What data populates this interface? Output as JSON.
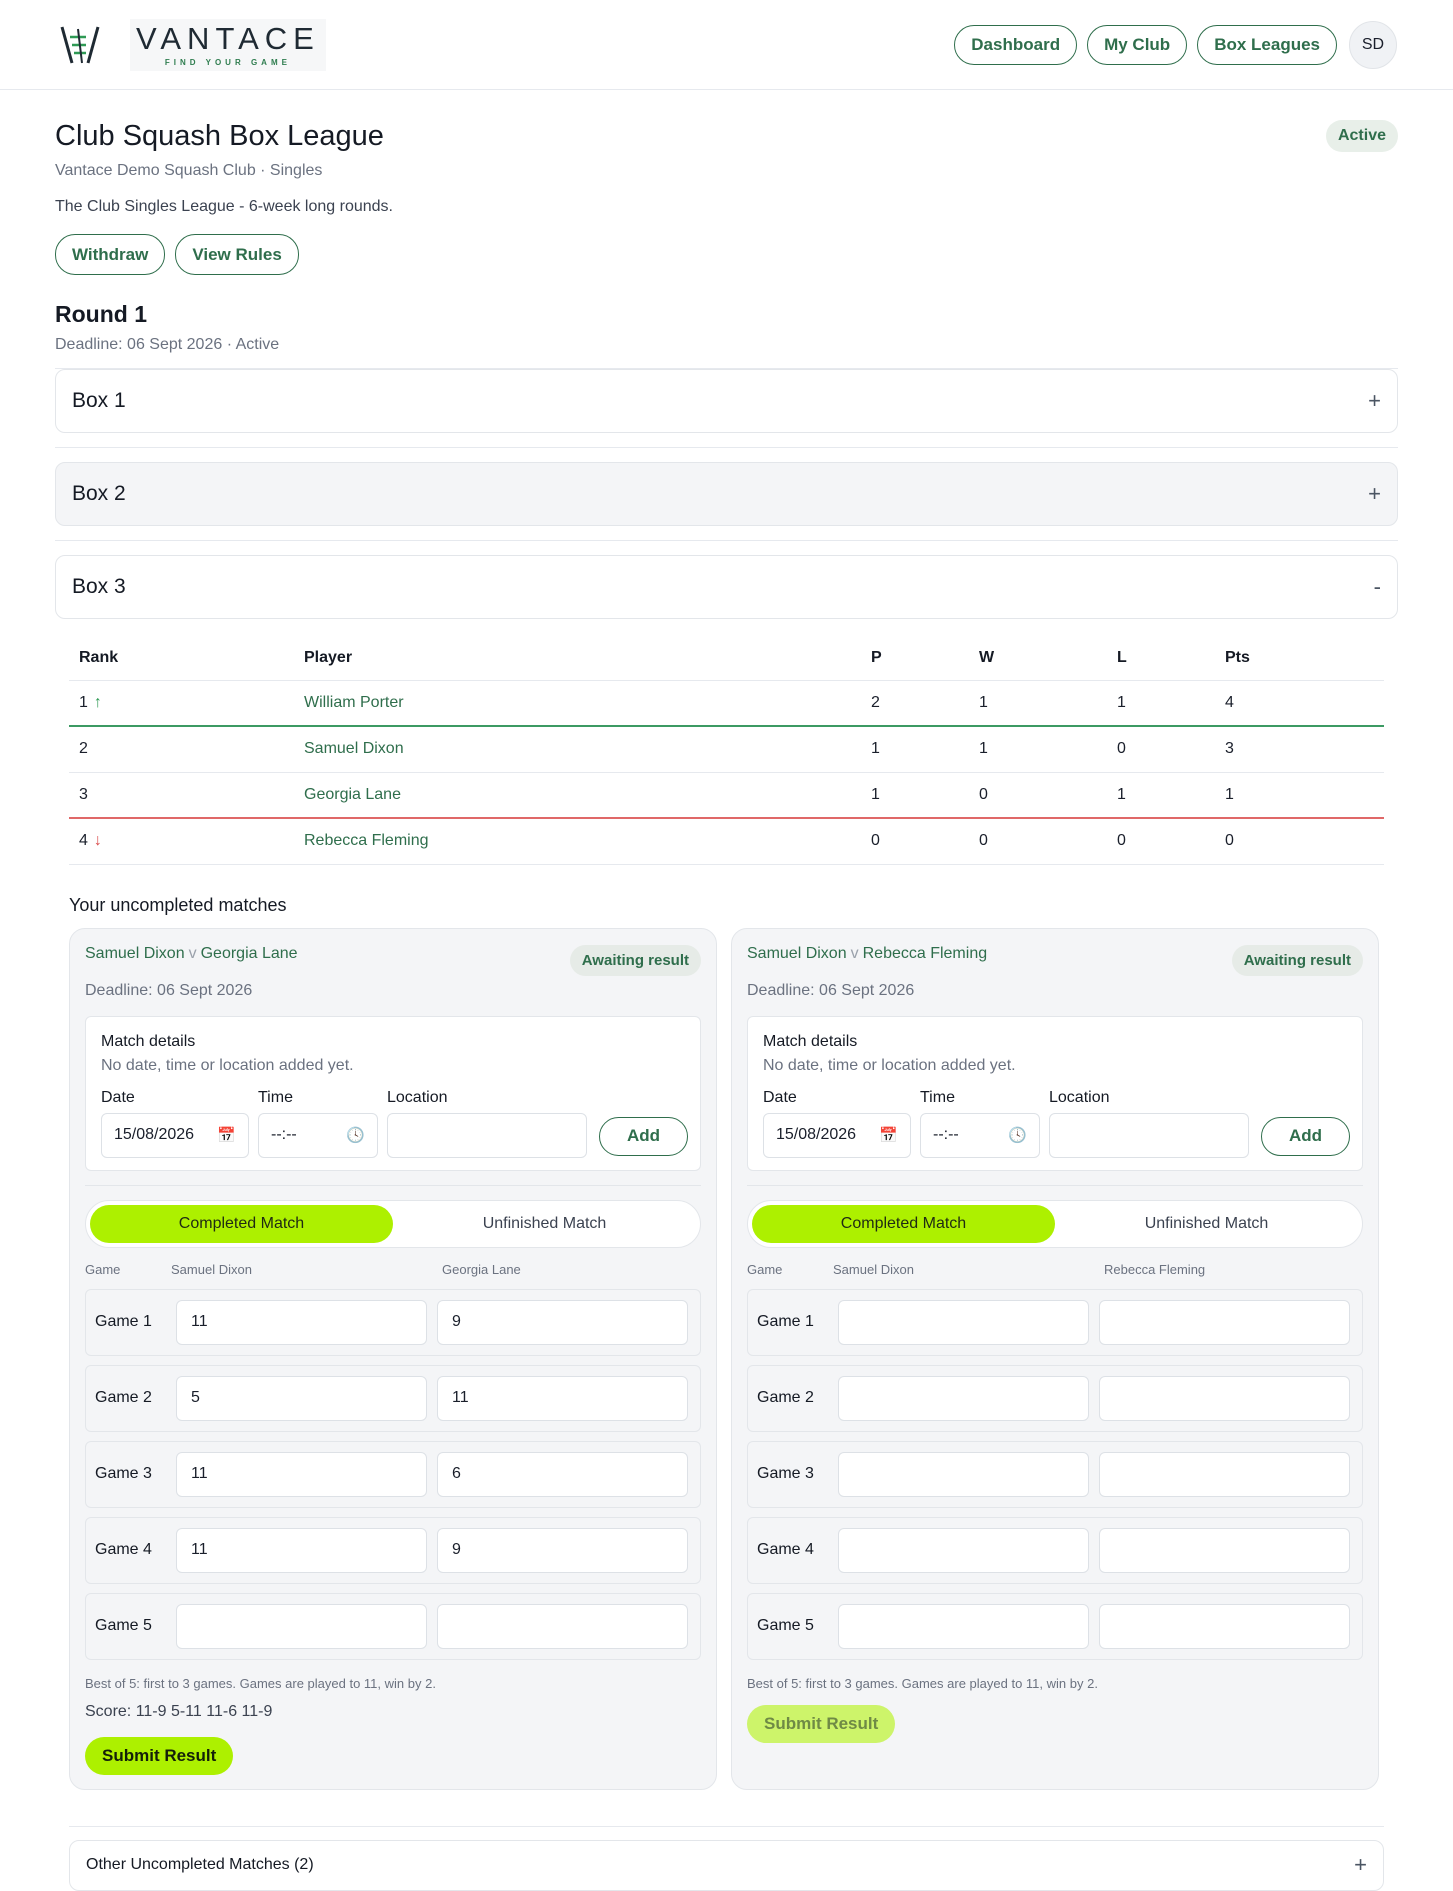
{
  "brand": {
    "name": "VANTACE",
    "tagline": "FIND YOUR GAME"
  },
  "nav": {
    "dashboard": "Dashboard",
    "my_club": "My Club",
    "box_leagues": "Box Leagues",
    "avatar_initials": "SD"
  },
  "league": {
    "title": "Club Squash Box League",
    "status": "Active",
    "subtitle": "Vantace Demo Squash Club · Singles",
    "description": "The Club Singles League - 6-week long rounds.",
    "withdraw_label": "Withdraw",
    "rules_label": "View Rules"
  },
  "round": {
    "title": "Round 1",
    "meta": "Deadline: 06 Sept 2026 · Active"
  },
  "boxes": [
    {
      "label": "Box 1",
      "toggle": "+"
    },
    {
      "label": "Box 2",
      "toggle": "+"
    },
    {
      "label": "Box 3",
      "toggle": "-"
    }
  ],
  "standings": {
    "headers": [
      "Rank",
      "Player",
      "P",
      "W",
      "L",
      "Pts"
    ],
    "rows": [
      {
        "rank": "1",
        "arrow": "↑",
        "player": "William Porter",
        "p": "2",
        "w": "1",
        "l": "1",
        "pts": "4"
      },
      {
        "rank": "2",
        "arrow": "",
        "player": "Samuel Dixon",
        "p": "1",
        "w": "1",
        "l": "0",
        "pts": "3"
      },
      {
        "rank": "3",
        "arrow": "",
        "player": "Georgia Lane",
        "p": "1",
        "w": "0",
        "l": "1",
        "pts": "1"
      },
      {
        "rank": "4",
        "arrow": "↓",
        "player": "Rebecca Fleming",
        "p": "0",
        "w": "0",
        "l": "0",
        "pts": "0"
      }
    ]
  },
  "uncompleted_title": "Your uncompleted matches",
  "matches": [
    {
      "player_a": "Samuel Dixon",
      "vs": "v",
      "player_b": "Georgia Lane",
      "status": "Awaiting result",
      "deadline": "Deadline: 06 Sept 2026",
      "details_title": "Match details",
      "details_sub": "No date, time or location added yet.",
      "date_label": "Date",
      "date_value": "15/08/2026",
      "time_label": "Time",
      "time_value": "--:--",
      "location_label": "Location",
      "location_value": "",
      "add_label": "Add",
      "seg_completed": "Completed Match",
      "seg_unfinished": "Unfinished Match",
      "col_game": "Game",
      "games": [
        {
          "label": "Game 1",
          "a": "11",
          "b": "9"
        },
        {
          "label": "Game 2",
          "a": "5",
          "b": "11"
        },
        {
          "label": "Game 3",
          "a": "11",
          "b": "6"
        },
        {
          "label": "Game 4",
          "a": "11",
          "b": "9"
        },
        {
          "label": "Game 5",
          "a": "",
          "b": ""
        }
      ],
      "hint": "Best of 5: first to 3 games. Games are played to 11, win by 2.",
      "score": "Score: 11-9 5-11 11-6 11-9",
      "submit_label": "Submit Result"
    },
    {
      "player_a": "Samuel Dixon",
      "vs": "v",
      "player_b": "Rebecca Fleming",
      "status": "Awaiting result",
      "deadline": "Deadline: 06 Sept 2026",
      "details_title": "Match details",
      "details_sub": "No date, time or location added yet.",
      "date_label": "Date",
      "date_value": "15/08/2026",
      "time_label": "Time",
      "time_value": "--:--",
      "location_label": "Location",
      "location_value": "",
      "add_label": "Add",
      "seg_completed": "Completed Match",
      "seg_unfinished": "Unfinished Match",
      "col_game": "Game",
      "games": [
        {
          "label": "Game 1",
          "a": "",
          "b": ""
        },
        {
          "label": "Game 2",
          "a": "",
          "b": ""
        },
        {
          "label": "Game 3",
          "a": "",
          "b": ""
        },
        {
          "label": "Game 4",
          "a": "",
          "b": ""
        },
        {
          "label": "Game 5",
          "a": "",
          "b": ""
        }
      ],
      "hint": "Best of 5: first to 3 games. Games are played to 11, win by 2.",
      "score": "",
      "submit_label": "Submit Result"
    }
  ],
  "other_matches": {
    "label": "Other Uncompleted Matches (2)",
    "toggle": "+"
  },
  "colors": {
    "accent": "#adf000",
    "brand_green": "#2f6e4c",
    "promote": "#3c9a63",
    "relegate": "#e06868"
  },
  "icons": {
    "date": "calendar-icon",
    "time": "clock-icon",
    "logo": "vantace-logo-icon"
  }
}
